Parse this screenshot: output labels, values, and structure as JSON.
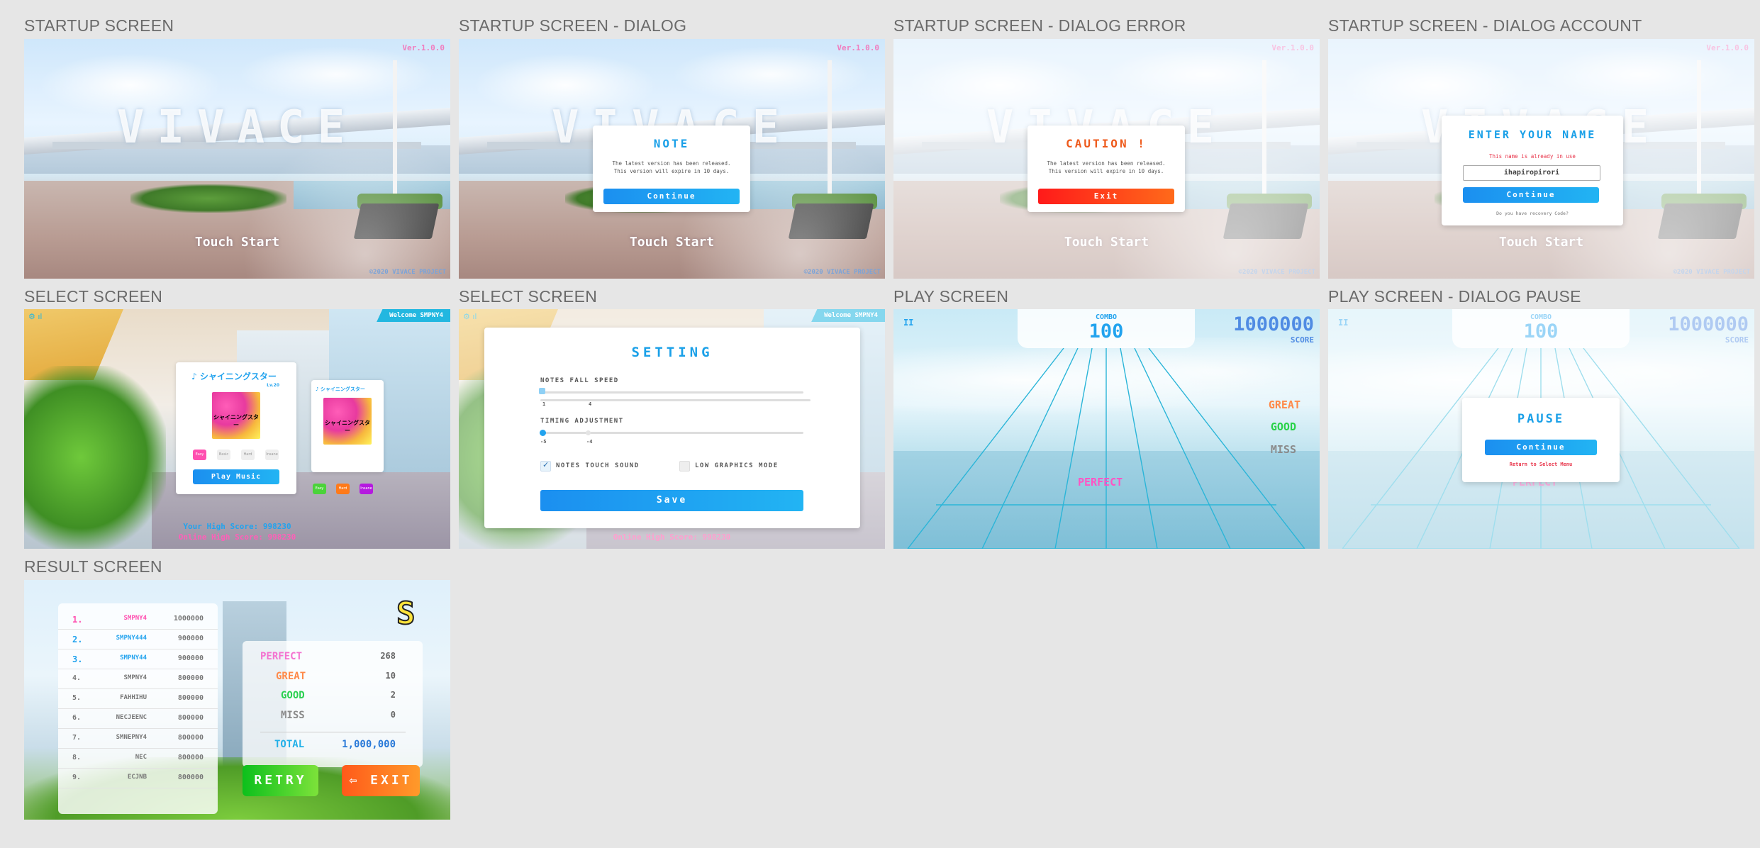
{
  "titles": {
    "startup": "STARTUP SCREEN",
    "startup_dialog": "STARTUP SCREEN - DIALOG",
    "startup_error": "STARTUP SCREEN - DIALOG ERROR",
    "startup_account": "STARTUP SCREEN - DIALOG ACCOUNT",
    "select": "SELECT SCREEN",
    "select2": "SELECT SCREEN",
    "play": "PLAY SCREEN",
    "play_pause": "PLAY SCREEN - DIALOG PAUSE",
    "result": "RESULT SCREEN"
  },
  "startup": {
    "logo": "VIVACE",
    "touch": "Touch Start",
    "version": "Ver.1.0.0",
    "copyright": "©2020 VIVACE PROJECT"
  },
  "note_dialog": {
    "title": "NOTE",
    "line1": "The latest version has been released.",
    "line2": "This version will expire in 10 days.",
    "button": "Continue"
  },
  "error_dialog": {
    "title": "CAUTION !",
    "line1": "The latest version has been released.",
    "line2": "This version will expire in 10 days.",
    "button": "Exit"
  },
  "account_dialog": {
    "title": "ENTER YOUR NAME",
    "error": "This name is already in use",
    "value": "ihapiropirori",
    "button": "Continue",
    "link": "Do you have recovery Code?"
  },
  "select": {
    "welcome": "Welcome SMPNY4",
    "song": "♪ シャイニングスター",
    "level": "Lv.20",
    "song_small": "♪ シャイニングスター",
    "jacket_text": "シャイニングスター",
    "diffs": [
      "Easy",
      "Basic",
      "Hard",
      "Insane"
    ],
    "diffs_small": [
      "Easy",
      "Hard",
      "Insane"
    ],
    "play": "Play Music",
    "your_high": "Your High Score: 998230",
    "online_high": "Online High Score: 998230"
  },
  "setting": {
    "title": "SETTING",
    "speed_label": "NOTES FALL SPEED",
    "speed_min": "1",
    "speed_val": "4",
    "timing_label": "TIMING ADJUSTMENT",
    "timing_min": "-5",
    "timing_val": "-4",
    "touch_sound": "NOTES TOUCH SOUND",
    "low_graphics": "LOW GRAPHICS MODE",
    "save": "Save",
    "online_high": "Online High Score: 998230"
  },
  "play": {
    "combo_label": "COMBO",
    "combo": "100",
    "score": "1000000",
    "score_label": "SCORE",
    "great": "GREAT",
    "good": "GOOD",
    "miss": "MISS",
    "perfect": "PERFECT",
    "pause_icon": "II"
  },
  "pause_dialog": {
    "title": "PAUSE",
    "button": "Continue",
    "link": "Return to Select Menu"
  },
  "result": {
    "grade": "S",
    "ranking": [
      {
        "rank": "1.",
        "name": "SMPNY4",
        "score": "1000000"
      },
      {
        "rank": "2.",
        "name": "SMPNY444",
        "score": "900000"
      },
      {
        "rank": "3.",
        "name": "SMPNY44",
        "score": "900000"
      },
      {
        "rank": "4.",
        "name": "SMPNY4",
        "score": "800000"
      },
      {
        "rank": "5.",
        "name": "FAHHIHU",
        "score": "800000"
      },
      {
        "rank": "6.",
        "name": "NECJEENC",
        "score": "800000"
      },
      {
        "rank": "7.",
        "name": "SMNEPNY4",
        "score": "800000"
      },
      {
        "rank": "8.",
        "name": "NEC",
        "score": "800000"
      },
      {
        "rank": "9.",
        "name": "ECJNB",
        "score": "800000"
      }
    ],
    "perfect_label": "PERFECT",
    "perfect": "268",
    "great_label": "GREAT",
    "great": "10",
    "good_label": "GOOD",
    "good": "2",
    "miss_label": "MISS",
    "miss": "0",
    "total_label": "TOTAL",
    "total": "1,000,000",
    "retry": "RETRY",
    "exit": "EXIT"
  }
}
